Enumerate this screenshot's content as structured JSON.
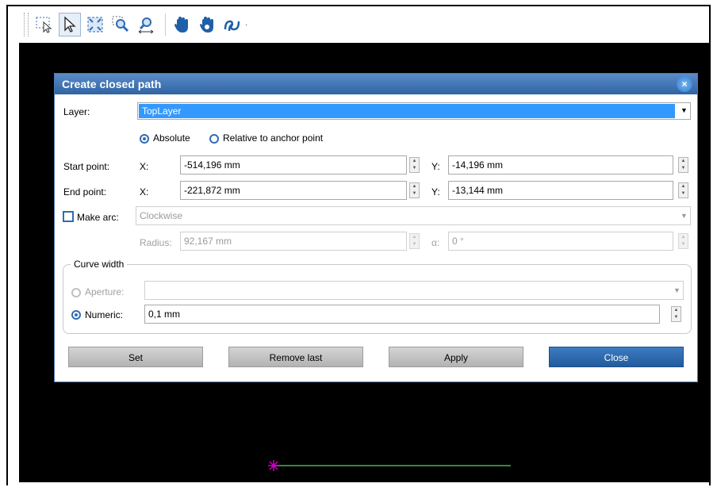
{
  "toolbar": {
    "icons": [
      "select-rectangle-icon",
      "pointer-arrow-icon",
      "zoom-fit-icon",
      "zoom-area-icon",
      "zoom-width-icon",
      "pan-hand-icon",
      "pan-hand-alt-icon",
      "path-tool-icon"
    ],
    "dropdown_glyph": "·"
  },
  "dialog": {
    "title": "Create closed path",
    "close_glyph": "×",
    "layer": {
      "label": "Layer:",
      "value": "TopLayer"
    },
    "mode": {
      "absolute_label": "Absolute",
      "relative_label": "Relative to anchor point",
      "selected": "Absolute"
    },
    "start_point": {
      "label": "Start point:",
      "x_label": "X:",
      "x_value": "-514,196 mm",
      "y_label": "Y:",
      "y_value": "-14,196 mm"
    },
    "end_point": {
      "label": "End point:",
      "x_label": "X:",
      "x_value": "-221,872 mm",
      "y_label": "Y:",
      "y_value": "-13,144 mm"
    },
    "make_arc": {
      "label": "Make arc:",
      "checked": false,
      "direction_value": "Clockwise"
    },
    "radius": {
      "label": "Radius:",
      "value": "92,167 mm",
      "alpha_label": "α:",
      "alpha_value": "0 °"
    },
    "curve_width": {
      "title": "Curve width",
      "aperture_label": "Aperture:",
      "aperture_value": "",
      "numeric_label": "Numeric:",
      "numeric_value": "0,1 mm",
      "selected": "Numeric"
    },
    "buttons": {
      "set": "Set",
      "remove_last": "Remove last",
      "apply": "Apply",
      "close": "Close"
    }
  },
  "canvas": {
    "background": "#000000",
    "marker_color": "#cc00cc",
    "line_color": "#2e8b3a",
    "marker_glyph": "✶"
  },
  "colors": {
    "accent": "#2f63a3",
    "selection": "#3399ff"
  }
}
